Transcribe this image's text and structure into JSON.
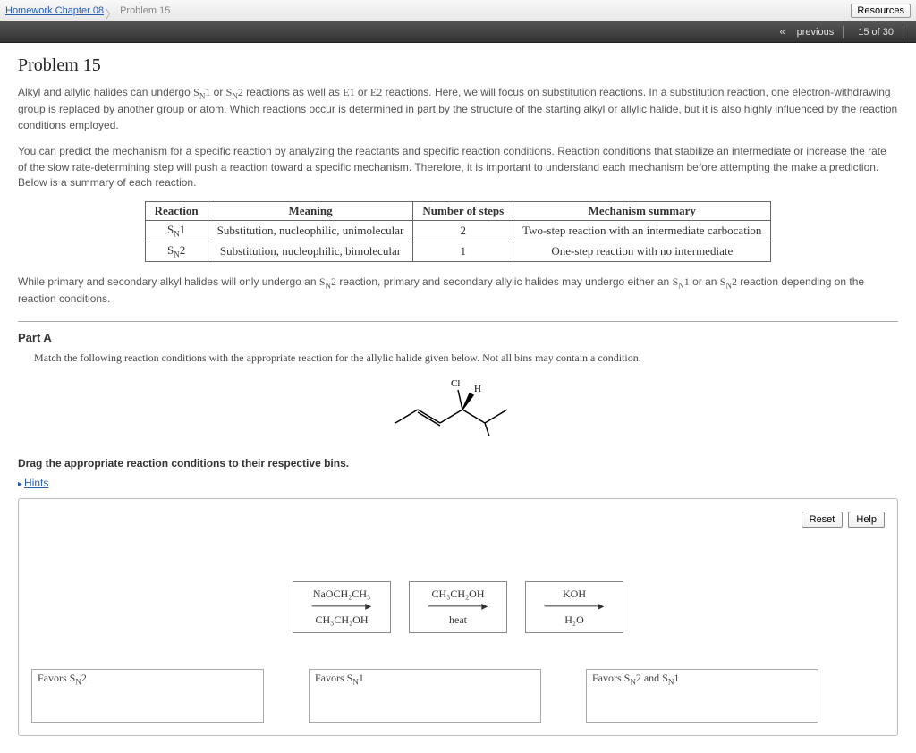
{
  "breadcrumb": {
    "home": "Homework Chapter 08",
    "current": "Problem 15",
    "resources": "Resources"
  },
  "darkbar": {
    "previous": "previous",
    "counter": "15 of 30"
  },
  "problem": {
    "title": "Problem 15",
    "para1_a": "Alkyl and allylic halides can undergo ",
    "para1_b": " or ",
    "para1_c": " reactions as well as ",
    "para1_d": " or ",
    "para1_e": " reactions. Here, we will focus on substitution reactions. In a substitution reaction, one electron-withdrawing group is replaced by another group or atom. Which reactions occur is determined in part by the structure of the starting alkyl or allylic halide, but it is also highly influenced by the reaction conditions employed.",
    "para2": "You can predict the mechanism for a specific reaction by analyzing the reactants and specific reaction conditions. Reaction conditions that stabilize an intermediate or increase the rate of the slow rate-determining step will push a reaction toward a specific mechanism. Therefore, it is important to understand each mechanism before attempting the make a prediction. Below is a summary of each reaction.",
    "table": {
      "h1": "Reaction",
      "h2": "Meaning",
      "h3": "Number of steps",
      "h4": "Mechanism summary",
      "r1c2": "Substitution, nucleophilic, unimolecular",
      "r1c3": "2",
      "r1c4": "Two-step reaction with an intermediate carbocation",
      "r2c2": "Substitution, nucleophilic, bimolecular",
      "r2c3": "1",
      "r2c4": "One-step reaction with no intermediate"
    },
    "para3_a": "While primary and secondary alkyl halides will only undergo an ",
    "para3_b": " reaction, primary and secondary allylic halides may undergo either an ",
    "para3_c": " or an ",
    "para3_d": " reaction depending on the reaction conditions."
  },
  "parta": {
    "heading": "Part A",
    "sub": "Match the following reaction conditions with the appropriate reaction for the allylic halide given below. Not all bins may contain a condition.",
    "instr": "Drag the appropriate reaction conditions to their respective bins.",
    "hints": "Hints",
    "reset": "Reset",
    "help": "Help",
    "chips": [
      {
        "top": "NaOCH₂CH₃",
        "bottom": "CH₃CH₂OH"
      },
      {
        "top": "CH₃CH₂OH",
        "bottom": "heat"
      },
      {
        "top": "KOH",
        "bottom": "H₂O"
      }
    ],
    "bins": {
      "b1": "Favors ",
      "b2": "Favors ",
      "b3": "Favors ",
      "and": " and "
    }
  },
  "mech": {
    "sn1": "S",
    "sn1n": "N",
    "sn1num": "1",
    "sn2": "S",
    "sn2n": "N",
    "sn2num": "2",
    "e1": "E1",
    "e2": "E2"
  },
  "molecule": {
    "cl": "Cl",
    "h": "H"
  }
}
